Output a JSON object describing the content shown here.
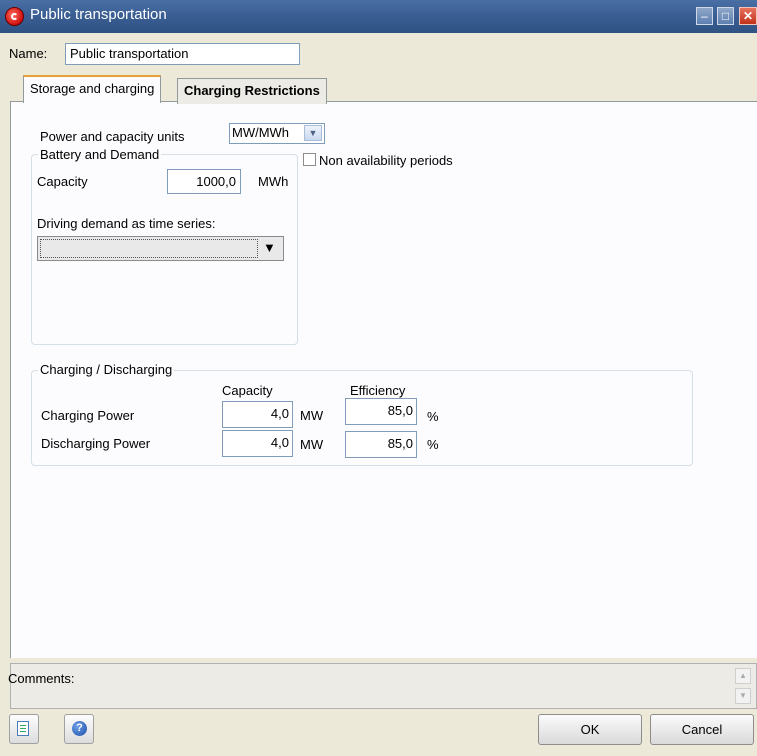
{
  "window": {
    "title": "Public transportation"
  },
  "name_row": {
    "label": "Name:",
    "value": "Public transportation"
  },
  "tabs": [
    {
      "label": "Storage and charging"
    },
    {
      "label": "Charging Restrictions"
    }
  ],
  "units": {
    "label": "Power and capacity units",
    "selected": "MW/MWh"
  },
  "battery": {
    "legend": "Battery and Demand",
    "capacity_label": "Capacity",
    "capacity_value": "1000,0",
    "capacity_unit": "MWh",
    "demand_label": "Driving demand as time series:",
    "demand_value": ""
  },
  "non_availability": {
    "label": "Non availability periods",
    "checked": false
  },
  "charging": {
    "legend": "Charging / Discharging",
    "col_capacity": "Capacity",
    "col_efficiency": "Efficiency",
    "rows": [
      {
        "label": "Charging Power",
        "capacity": "4,0",
        "capacity_unit": "MW",
        "efficiency": "85,0",
        "efficiency_unit": "%"
      },
      {
        "label": "Discharging Power",
        "capacity": "4,0",
        "capacity_unit": "MW",
        "efficiency": "85,0",
        "efficiency_unit": "%"
      }
    ]
  },
  "comments": {
    "label": "Comments:"
  },
  "buttons": {
    "ok": "OK",
    "cancel": "Cancel"
  },
  "icons": [
    "app-icon",
    "minimize-icon",
    "maximize-icon",
    "close-icon",
    "dropdown-arrow-icon",
    "document-icon",
    "help-icon",
    "scroll-up-icon",
    "scroll-down-icon"
  ]
}
